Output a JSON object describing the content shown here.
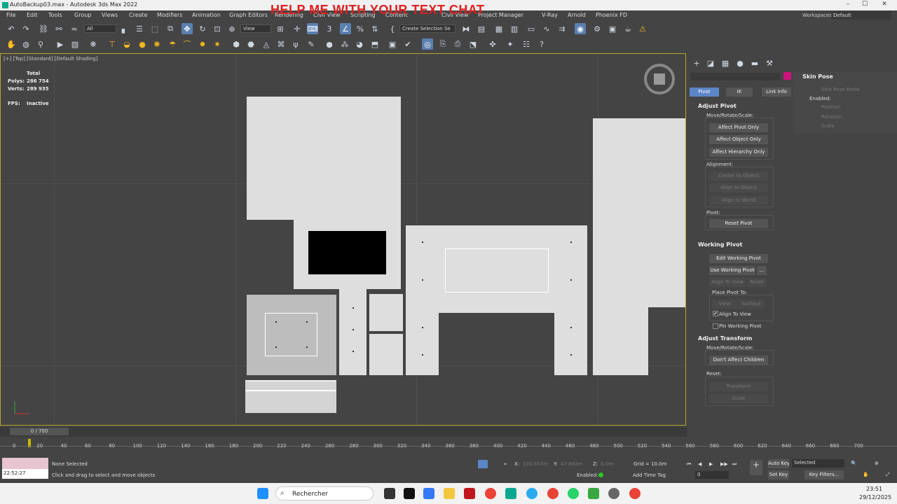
{
  "window": {
    "title": "AutoBackup03.max - Autodesk 3ds Max 2022",
    "controls": [
      "–",
      "☐",
      "✕"
    ]
  },
  "menubar": {
    "items": [
      "File",
      "Edit",
      "Tools",
      "Group",
      "Views",
      "Create",
      "Modifiers",
      "Animation",
      "Graph Editors",
      "Rendering",
      "Civil View",
      "Scripting",
      "Content",
      "Civil View",
      "Project Manager",
      "V-Ray",
      "Arnold",
      "Phoenix FD"
    ],
    "overlay_banner": "HELP ME WITH YOUR TEXT CHAT",
    "workspaces_label": "Workspaces:",
    "workspaces_value": "Default"
  },
  "toolbar1": {
    "selection_filter": "All",
    "ref_coord": "View",
    "named_selection": "Create Selection Se"
  },
  "viewport": {
    "label": "[+] [Top] [Standard] [Default Shading]",
    "stats": {
      "header": "Total",
      "polys_label": "Polys:",
      "polys_value": "286 754",
      "verts_label": "Verts:",
      "verts_value": "289 935",
      "fps_label": "FPS:",
      "fps_value": "Inactive"
    }
  },
  "command_panel": {
    "skin_pose": {
      "title": "Skin Pose",
      "mode": "Skin Pose Mode",
      "enabled": "Enabled:",
      "position": "Position",
      "rotation": "Rotation",
      "scale": "Scale"
    },
    "tabs": {
      "pivot": "Pivot",
      "ik": "IK",
      "link_info": "Link Info"
    },
    "adjust_pivot": {
      "title": "Adjust Pivot",
      "move_label": "Move/Rotate/Scale:",
      "affect_pivot_only": "Affect Pivot Only",
      "affect_object_only": "Affect Object Only",
      "affect_hierarchy_only": "Affect Hierarchy Only",
      "alignment_label": "Alignment:",
      "center_to_object": "Center to Object",
      "align_to_object": "Align to Object",
      "align_to_world": "Align to World",
      "pivot_label": "Pivot:",
      "reset_pivot": "Reset Pivot"
    },
    "working_pivot": {
      "title": "Working Pivot",
      "edit_working_pivot": "Edit Working Pivot",
      "use_working_pivot": "Use Working Pivot",
      "dots": "...",
      "align_to_view": "Align To View",
      "reset": "Reset",
      "place_label": "Place Pivot To:",
      "view": "View",
      "surface": "Surface",
      "align_to_view_check": "Align To View",
      "pin_working_pivot": "Pin Working Pivot"
    },
    "adjust_transform": {
      "title": "Adjust Transform",
      "move_label": "Move/Rotate/Scale:",
      "dont_affect_children": "Don't Affect Children",
      "reset_label": "Reset:",
      "transform": "Transform",
      "scale": "Scale"
    }
  },
  "timeline": {
    "frame_counter": "0 / 700",
    "ticks": [
      "0",
      "20",
      "40",
      "60",
      "80",
      "100",
      "120",
      "140",
      "160",
      "180",
      "200",
      "220",
      "240",
      "260",
      "280",
      "300",
      "320",
      "340",
      "360",
      "380",
      "400",
      "420",
      "440",
      "460",
      "480",
      "500",
      "520",
      "540",
      "560",
      "580",
      "600",
      "620",
      "640",
      "660",
      "680",
      "700"
    ]
  },
  "statusbar": {
    "time": "22:52:27",
    "selection": "None Selected",
    "prompt": "Click and drag to select and move objects",
    "x_label": "X:",
    "x_value": "103.557m",
    "y_label": "Y:",
    "y_value": "47.892m",
    "z_label": "Z:",
    "z_value": "0.0m",
    "grid": "Grid = 10.0m",
    "enabled": "Enabled:",
    "add_time_tag": "Add Time Tag",
    "auto_key": "Auto Key",
    "set_key": "Set Key",
    "selected": "Selected",
    "key_filters": "Key Filters...",
    "frame_value": "0"
  },
  "taskbar": {
    "search": "Rechercher",
    "clock_time": "23:51",
    "clock_date": "29/12/2025"
  },
  "colors": {
    "viewport_border": "#b8a62a",
    "active_blue": "#5b86c7",
    "banner_red": "#e02020",
    "material_swatch": "#d0127e"
  }
}
